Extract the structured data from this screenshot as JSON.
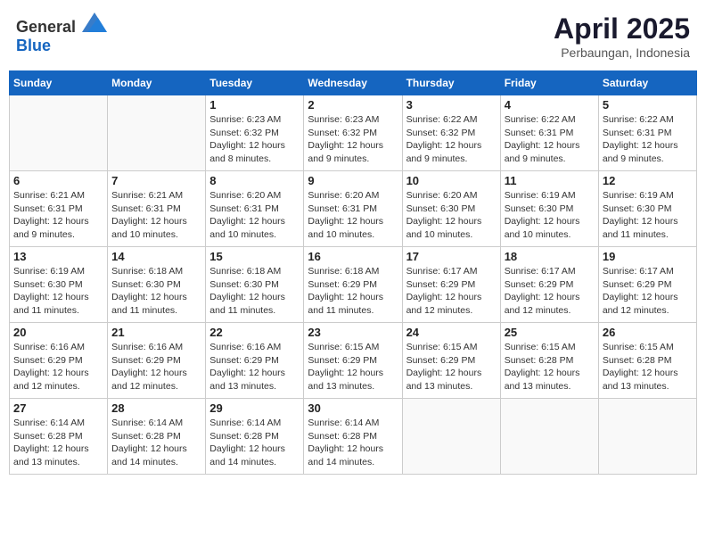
{
  "header": {
    "logo_general": "General",
    "logo_blue": "Blue",
    "month_year": "April 2025",
    "location": "Perbaungan, Indonesia"
  },
  "weekdays": [
    "Sunday",
    "Monday",
    "Tuesday",
    "Wednesday",
    "Thursday",
    "Friday",
    "Saturday"
  ],
  "weeks": [
    [
      {
        "day": "",
        "info": ""
      },
      {
        "day": "",
        "info": ""
      },
      {
        "day": "1",
        "info": "Sunrise: 6:23 AM\nSunset: 6:32 PM\nDaylight: 12 hours and 8 minutes."
      },
      {
        "day": "2",
        "info": "Sunrise: 6:23 AM\nSunset: 6:32 PM\nDaylight: 12 hours and 9 minutes."
      },
      {
        "day": "3",
        "info": "Sunrise: 6:22 AM\nSunset: 6:32 PM\nDaylight: 12 hours and 9 minutes."
      },
      {
        "day": "4",
        "info": "Sunrise: 6:22 AM\nSunset: 6:31 PM\nDaylight: 12 hours and 9 minutes."
      },
      {
        "day": "5",
        "info": "Sunrise: 6:22 AM\nSunset: 6:31 PM\nDaylight: 12 hours and 9 minutes."
      }
    ],
    [
      {
        "day": "6",
        "info": "Sunrise: 6:21 AM\nSunset: 6:31 PM\nDaylight: 12 hours and 9 minutes."
      },
      {
        "day": "7",
        "info": "Sunrise: 6:21 AM\nSunset: 6:31 PM\nDaylight: 12 hours and 10 minutes."
      },
      {
        "day": "8",
        "info": "Sunrise: 6:20 AM\nSunset: 6:31 PM\nDaylight: 12 hours and 10 minutes."
      },
      {
        "day": "9",
        "info": "Sunrise: 6:20 AM\nSunset: 6:31 PM\nDaylight: 12 hours and 10 minutes."
      },
      {
        "day": "10",
        "info": "Sunrise: 6:20 AM\nSunset: 6:30 PM\nDaylight: 12 hours and 10 minutes."
      },
      {
        "day": "11",
        "info": "Sunrise: 6:19 AM\nSunset: 6:30 PM\nDaylight: 12 hours and 10 minutes."
      },
      {
        "day": "12",
        "info": "Sunrise: 6:19 AM\nSunset: 6:30 PM\nDaylight: 12 hours and 11 minutes."
      }
    ],
    [
      {
        "day": "13",
        "info": "Sunrise: 6:19 AM\nSunset: 6:30 PM\nDaylight: 12 hours and 11 minutes."
      },
      {
        "day": "14",
        "info": "Sunrise: 6:18 AM\nSunset: 6:30 PM\nDaylight: 12 hours and 11 minutes."
      },
      {
        "day": "15",
        "info": "Sunrise: 6:18 AM\nSunset: 6:30 PM\nDaylight: 12 hours and 11 minutes."
      },
      {
        "day": "16",
        "info": "Sunrise: 6:18 AM\nSunset: 6:29 PM\nDaylight: 12 hours and 11 minutes."
      },
      {
        "day": "17",
        "info": "Sunrise: 6:17 AM\nSunset: 6:29 PM\nDaylight: 12 hours and 12 minutes."
      },
      {
        "day": "18",
        "info": "Sunrise: 6:17 AM\nSunset: 6:29 PM\nDaylight: 12 hours and 12 minutes."
      },
      {
        "day": "19",
        "info": "Sunrise: 6:17 AM\nSunset: 6:29 PM\nDaylight: 12 hours and 12 minutes."
      }
    ],
    [
      {
        "day": "20",
        "info": "Sunrise: 6:16 AM\nSunset: 6:29 PM\nDaylight: 12 hours and 12 minutes."
      },
      {
        "day": "21",
        "info": "Sunrise: 6:16 AM\nSunset: 6:29 PM\nDaylight: 12 hours and 12 minutes."
      },
      {
        "day": "22",
        "info": "Sunrise: 6:16 AM\nSunset: 6:29 PM\nDaylight: 12 hours and 13 minutes."
      },
      {
        "day": "23",
        "info": "Sunrise: 6:15 AM\nSunset: 6:29 PM\nDaylight: 12 hours and 13 minutes."
      },
      {
        "day": "24",
        "info": "Sunrise: 6:15 AM\nSunset: 6:29 PM\nDaylight: 12 hours and 13 minutes."
      },
      {
        "day": "25",
        "info": "Sunrise: 6:15 AM\nSunset: 6:28 PM\nDaylight: 12 hours and 13 minutes."
      },
      {
        "day": "26",
        "info": "Sunrise: 6:15 AM\nSunset: 6:28 PM\nDaylight: 12 hours and 13 minutes."
      }
    ],
    [
      {
        "day": "27",
        "info": "Sunrise: 6:14 AM\nSunset: 6:28 PM\nDaylight: 12 hours and 13 minutes."
      },
      {
        "day": "28",
        "info": "Sunrise: 6:14 AM\nSunset: 6:28 PM\nDaylight: 12 hours and 14 minutes."
      },
      {
        "day": "29",
        "info": "Sunrise: 6:14 AM\nSunset: 6:28 PM\nDaylight: 12 hours and 14 minutes."
      },
      {
        "day": "30",
        "info": "Sunrise: 6:14 AM\nSunset: 6:28 PM\nDaylight: 12 hours and 14 minutes."
      },
      {
        "day": "",
        "info": ""
      },
      {
        "day": "",
        "info": ""
      },
      {
        "day": "",
        "info": ""
      }
    ]
  ]
}
